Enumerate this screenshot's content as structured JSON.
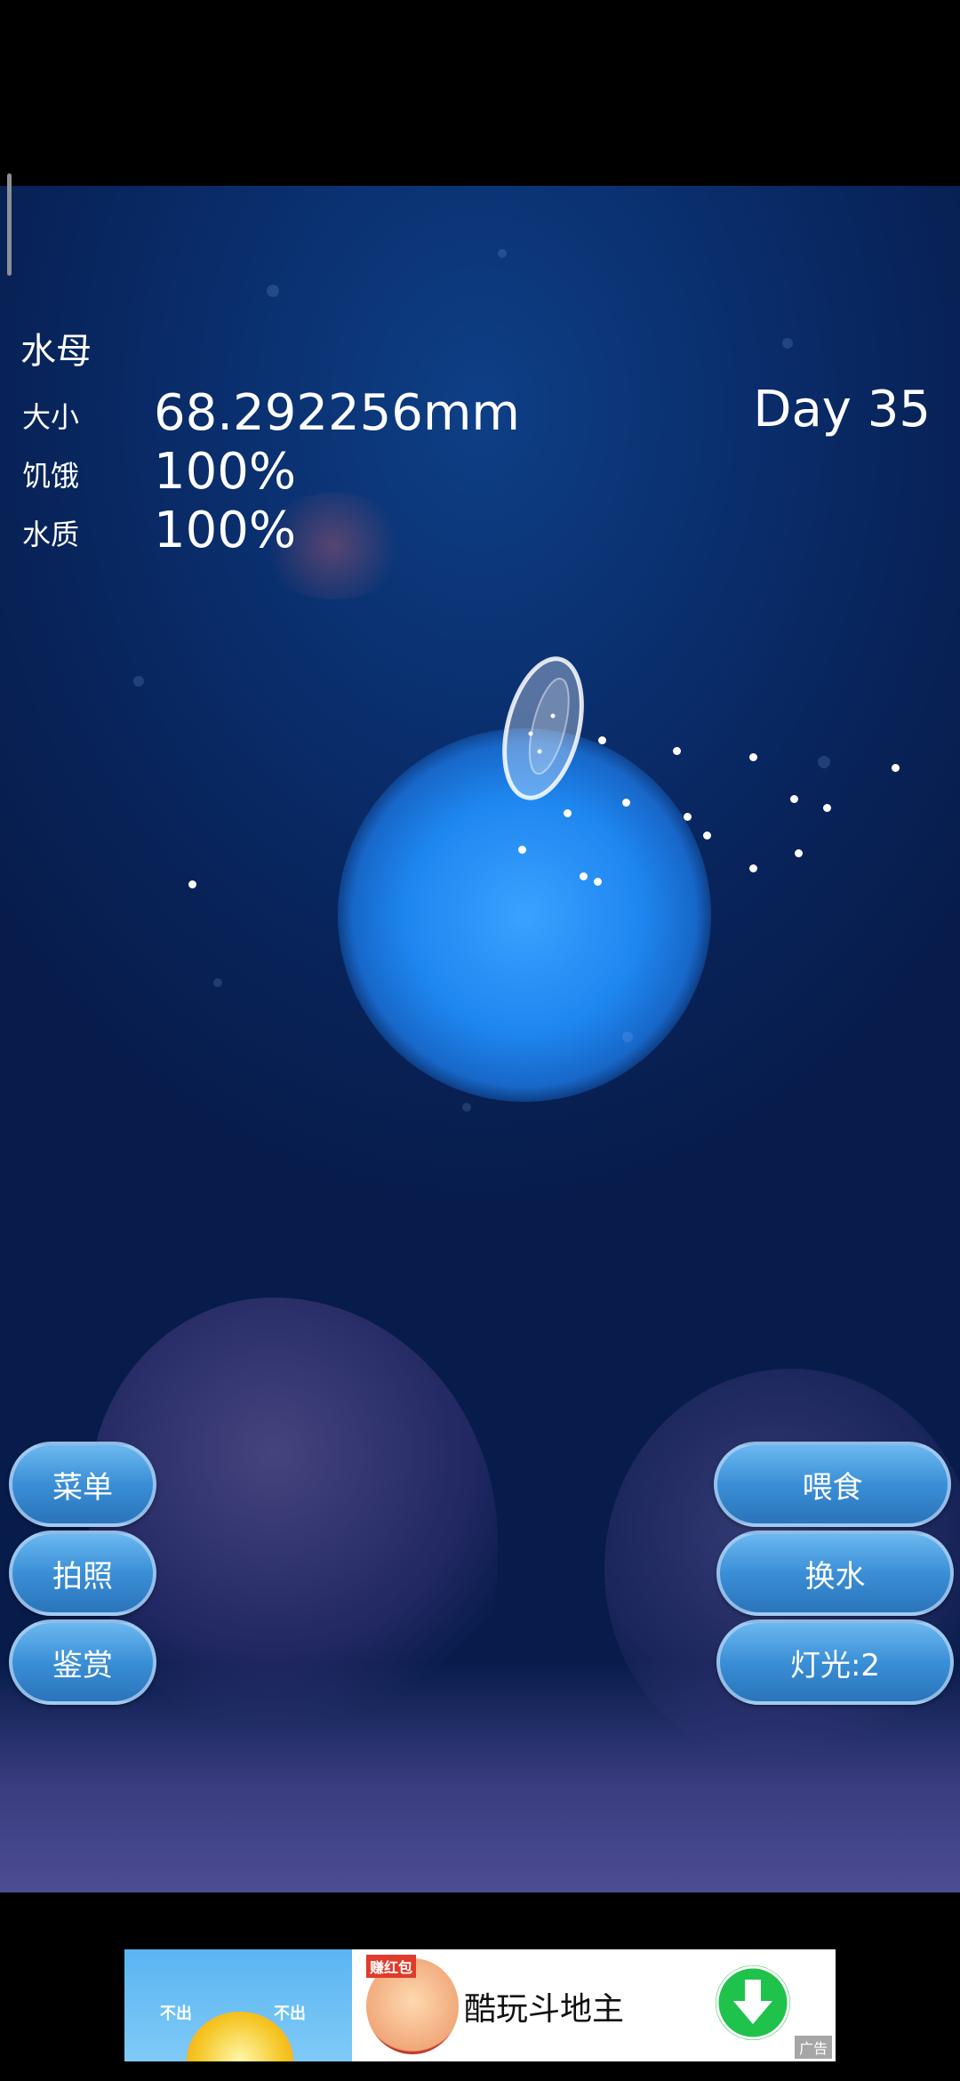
{
  "jellyfish": {
    "title": "水母",
    "size_label": "大小",
    "size_value": "68.292256mm",
    "hunger_label": "饥饿",
    "hunger_value": "100%",
    "water_label": "水质",
    "water_value": "100%",
    "day": "Day 35"
  },
  "buttons": {
    "menu": "菜单",
    "photo": "拍照",
    "appreciate": "鉴赏",
    "feed": "喂食",
    "change_water": "换水",
    "light": "灯光:2"
  },
  "ad": {
    "app_name": "酷玩斗地主",
    "tag": "广告",
    "banner_text_1": "不出",
    "banner_text_2": "不出",
    "badge": "赚红包"
  },
  "icons": [
    "jellyfish-icon",
    "download-icon"
  ],
  "colors": {
    "button": "#3a8fd6",
    "water": "#08245b",
    "glow": "#3aa2ff"
  }
}
